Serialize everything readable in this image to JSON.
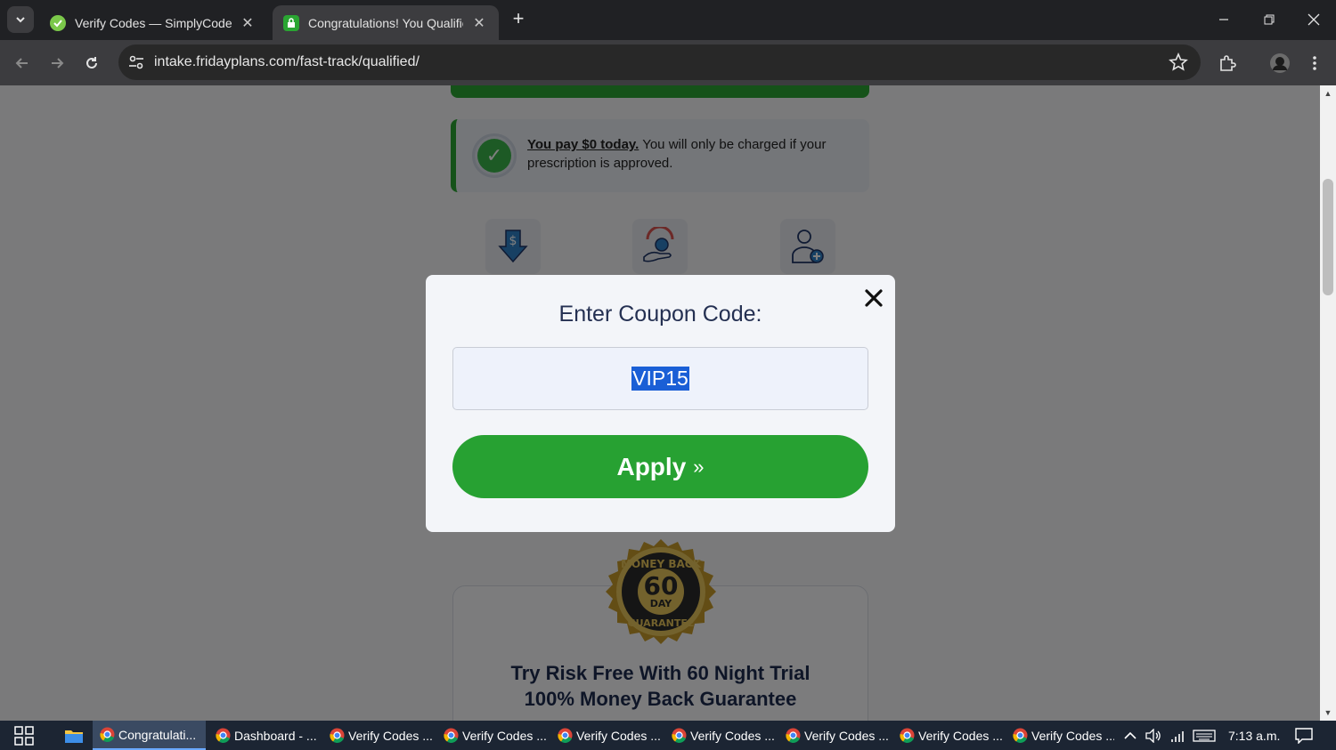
{
  "browser": {
    "tabs": [
      {
        "title": "Verify Codes — SimplyCodes",
        "active": false
      },
      {
        "title": "Congratulations! You Qualified!",
        "active": true
      }
    ],
    "url": "intake.fridayplans.com/fast-track/qualified/"
  },
  "page": {
    "payment_note": {
      "emphasis": "You pay $0 today.",
      "text": " You will only be charged if your prescription is approved."
    },
    "trial_line1": "Try Risk Free With 60 Night Trial",
    "trial_line2": "100% Money Back Guarantee",
    "seal": {
      "top": "MONEY BACK",
      "number": "60",
      "unit": "DAY",
      "bottom": "GUARANTEE"
    }
  },
  "modal": {
    "title": "Enter Coupon Code:",
    "coupon_value": "VIP15",
    "apply_label": "Apply",
    "apply_suffix": "»"
  },
  "taskbar": {
    "apps": [
      "Congratulati...",
      "Dashboard - ...",
      "Verify Codes ...",
      "Verify Codes ...",
      "Verify Codes ...",
      "Verify Codes ...",
      "Verify Codes ...",
      "Verify Codes ...",
      "Verify Codes ..."
    ],
    "time": "7:13 a.m."
  },
  "colors": {
    "brand_green": "#27a132",
    "heading_navy": "#243052",
    "selection_blue": "#1a5fd6"
  }
}
